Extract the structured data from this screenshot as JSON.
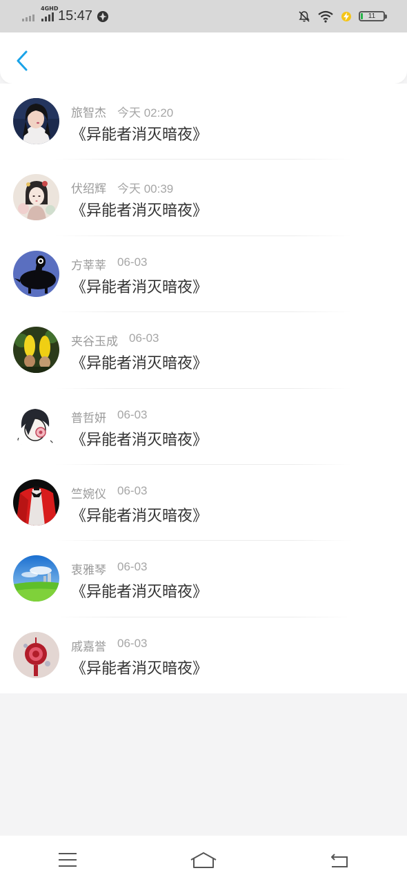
{
  "status_bar": {
    "time": "15:47",
    "network": "4GHD",
    "battery": "11"
  },
  "colors": {
    "accent": "#1aa3e8",
    "status_bg": "#d9d9d9",
    "page_bg": "#f4f4f5",
    "meta_text": "#a6a6a6",
    "title_text": "#333333"
  },
  "header": {
    "back_icon": "chevron-left-icon"
  },
  "items": [
    {
      "name": "旅智杰",
      "time": "今天 02:20",
      "title": "《异能者消灭暗夜》"
    },
    {
      "name": "伏绍辉",
      "time": "今天 00:39",
      "title": "《异能者消灭暗夜》"
    },
    {
      "name": "方莘莘",
      "time": "06-03",
      "title": "《异能者消灭暗夜》"
    },
    {
      "name": "夹谷玉成",
      "time": "06-03",
      "title": "《异能者消灭暗夜》"
    },
    {
      "name": "普哲妍",
      "time": "06-03",
      "title": "《异能者消灭暗夜》"
    },
    {
      "name": "竺婉仪",
      "time": "06-03",
      "title": "《异能者消灭暗夜》"
    },
    {
      "name": "衷雅琴",
      "time": "06-03",
      "title": "《异能者消灭暗夜》"
    },
    {
      "name": "戚嘉誉",
      "time": "06-03",
      "title": "《异能者消灭暗夜》"
    }
  ],
  "navbar": {
    "icons": [
      "menu-icon",
      "home-icon",
      "back-icon"
    ]
  }
}
